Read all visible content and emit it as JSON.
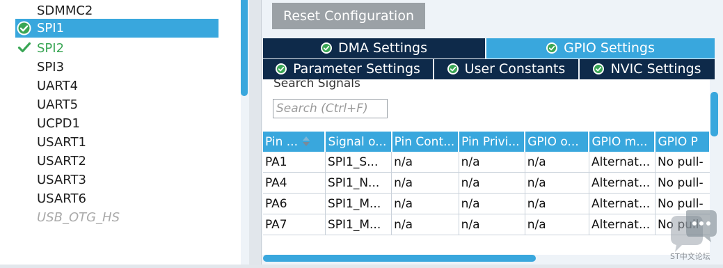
{
  "peripherals": {
    "items": [
      {
        "label": "SDMMC2",
        "state": "normal"
      },
      {
        "label": "SPI1",
        "state": "selected"
      },
      {
        "label": "SPI2",
        "state": "checked"
      },
      {
        "label": "SPI3",
        "state": "normal"
      },
      {
        "label": "UART4",
        "state": "normal"
      },
      {
        "label": "UART5",
        "state": "normal"
      },
      {
        "label": "UCPD1",
        "state": "normal"
      },
      {
        "label": "USART1",
        "state": "normal"
      },
      {
        "label": "USART2",
        "state": "normal"
      },
      {
        "label": "USART3",
        "state": "normal"
      },
      {
        "label": "USART6",
        "state": "normal"
      },
      {
        "label": "USB_OTG_HS",
        "state": "disabled"
      }
    ]
  },
  "config": {
    "reset_label": "Reset Configuration",
    "tabs": [
      {
        "label": "DMA Settings",
        "active": false
      },
      {
        "label": "GPIO Settings",
        "active": true
      },
      {
        "label": "Parameter Settings",
        "active": false
      },
      {
        "label": "User Constants",
        "active": false
      },
      {
        "label": "NVIC Settings",
        "active": false
      }
    ],
    "search": {
      "label": "Search Signals",
      "placeholder": "Search (Ctrl+F)",
      "value": ""
    },
    "table": {
      "headers": [
        "Pin ...",
        "Signal o...",
        "Pin Cont...",
        "Pin Privi...",
        "GPIO o...",
        "GPIO m...",
        "GPIO P"
      ],
      "rows": [
        [
          "PA1",
          "SPI1_S...",
          "n/a",
          "n/a",
          "n/a",
          "Alternat...",
          "No pull-"
        ],
        [
          "PA4",
          "SPI1_N...",
          "n/a",
          "n/a",
          "n/a",
          "Alternat...",
          "No pull-"
        ],
        [
          "PA6",
          "SPI1_M...",
          "n/a",
          "n/a",
          "n/a",
          "Alternat...",
          "No pull-"
        ],
        [
          "PA7",
          "SPI1_M...",
          "n/a",
          "n/a",
          "n/a",
          "Alternat...",
          "No pull-"
        ]
      ]
    }
  },
  "watermark": {
    "text": "ST中文论坛"
  },
  "colors": {
    "accent": "#39a7dd",
    "tab_dark": "#0e2a4a",
    "check_green": "#3aa655",
    "button_gray": "#9ba1a6",
    "panel_bg": "#eef3f8"
  },
  "icons": {
    "selected_check": "check-circle-icon",
    "checked": "checkmark-icon",
    "tab": "check-circle-icon",
    "sort": "sort-arrows-icon"
  }
}
